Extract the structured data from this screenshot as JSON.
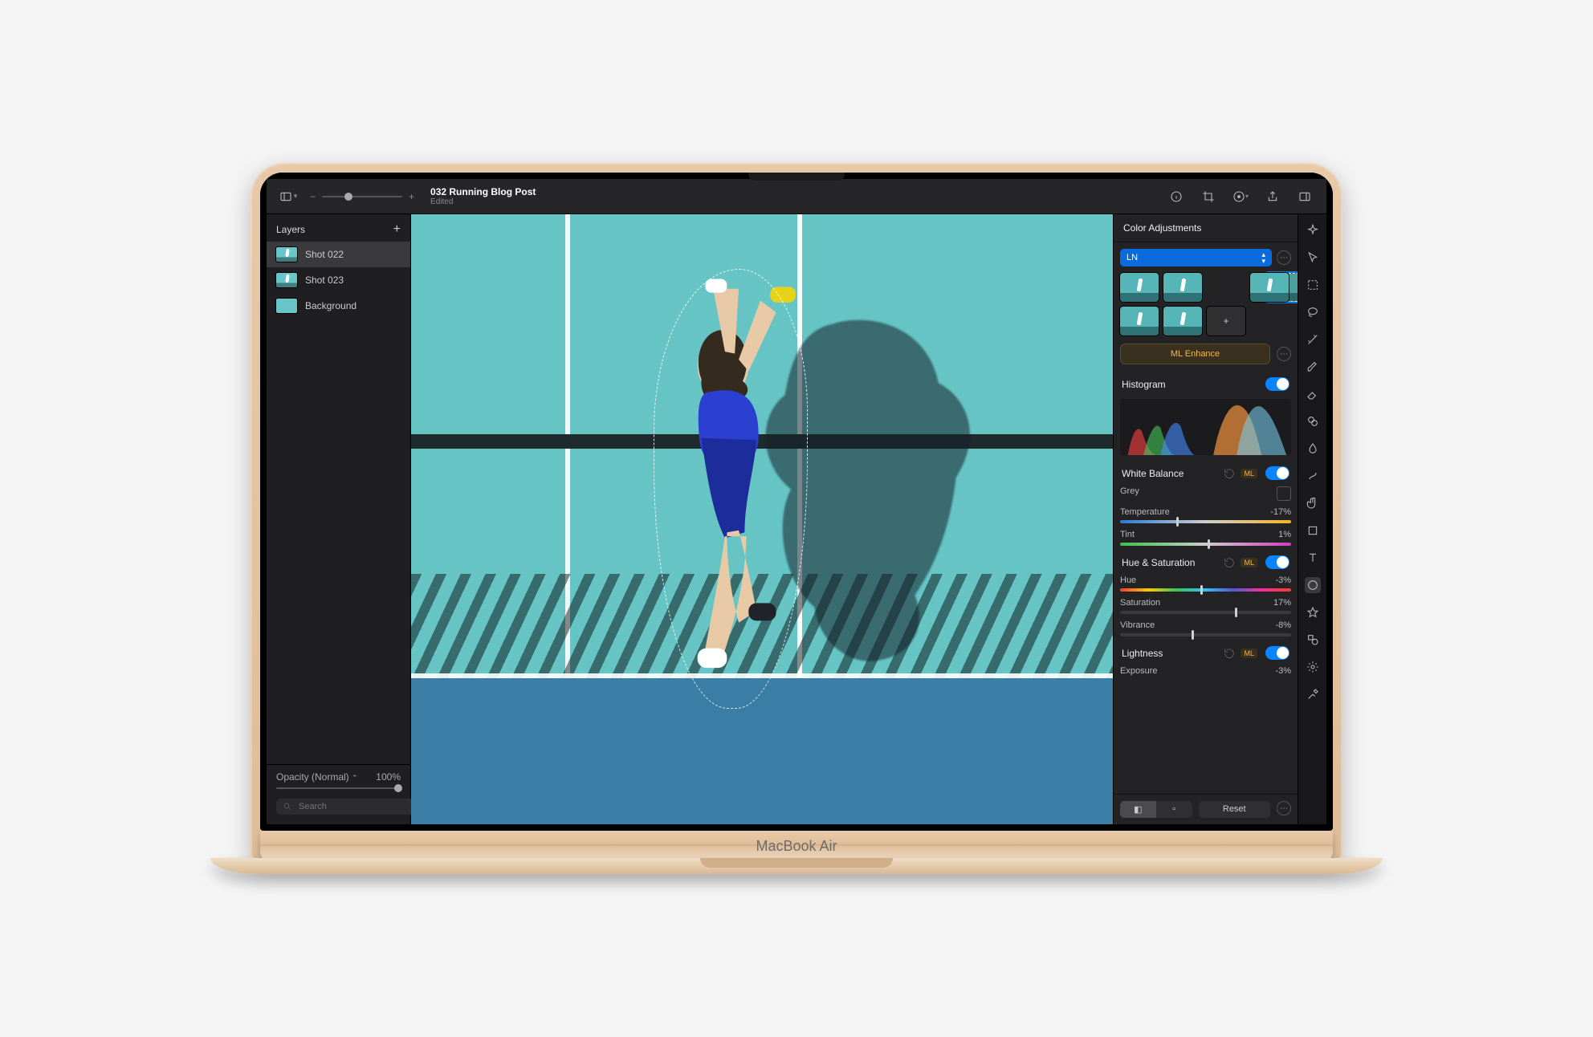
{
  "toolbar": {
    "title": "032 Running Blog Post",
    "subtitle": "Edited",
    "zoom_minus": "−",
    "zoom_plus": "+"
  },
  "sidebar": {
    "title": "Layers",
    "add": "+",
    "layers": [
      {
        "name": "Shot 022",
        "kind": "image"
      },
      {
        "name": "Shot 023",
        "kind": "image"
      },
      {
        "name": "Background",
        "kind": "bg"
      }
    ],
    "opacity_label": "Opacity (Normal)",
    "opacity_value": "100%",
    "search_placeholder": "Search"
  },
  "inspector": {
    "title": "Color Adjustments",
    "preset_selected": "LN",
    "preset_count": 7,
    "preset_add": "+",
    "ml_enhance": "ML Enhance",
    "histogram_label": "Histogram",
    "sections": {
      "white_balance": {
        "label": "White Balance",
        "grey_label": "Grey",
        "temperature_label": "Temperature",
        "temperature_value": "-17%",
        "tint_label": "Tint",
        "tint_value": "1%"
      },
      "hue_sat": {
        "label": "Hue & Saturation",
        "hue_label": "Hue",
        "hue_value": "-3%",
        "saturation_label": "Saturation",
        "saturation_value": "17%",
        "vibrance_label": "Vibrance",
        "vibrance_value": "-8%"
      },
      "lightness": {
        "label": "Lightness",
        "exposure_label": "Exposure",
        "exposure_value": "-3%"
      }
    },
    "reset": "Reset"
  },
  "hinge_label": "MacBook Air",
  "tool_icons": [
    "sparkle",
    "pointer",
    "marquee",
    "lasso",
    "wand",
    "brush",
    "eraser",
    "clone",
    "blur",
    "stamp",
    "hand",
    "crop",
    "shape",
    "text",
    "bucket",
    "star",
    "gear",
    "eyedropper"
  ]
}
